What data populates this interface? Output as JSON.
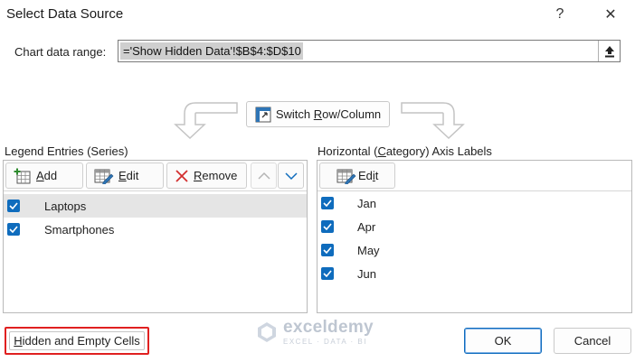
{
  "window": {
    "title": "Select Data Source",
    "help_glyph": "?",
    "close_glyph": "✕"
  },
  "range": {
    "label": "Chart data range:",
    "value": "='Show Hidden Data'!$B$4:$D$10"
  },
  "switch": {
    "label_prefix": "Switch ",
    "label_accel": "R",
    "label_rest": "ow/Column"
  },
  "legend": {
    "title_prefix": "Le",
    "title_accel": "g",
    "title_rest": "end Entries (Series)",
    "add_accel": "A",
    "add_rest": "dd",
    "edit_accel": "E",
    "edit_rest": "dit",
    "remove_accel": "R",
    "remove_rest": "emove",
    "series": [
      {
        "label": "Laptops",
        "checked": true,
        "selected": true
      },
      {
        "label": "Smartphones",
        "checked": true,
        "selected": false
      }
    ]
  },
  "axis": {
    "title_prefix": "Horizontal (",
    "title_accel": "C",
    "title_rest": "ategory) Axis Labels",
    "edit_prefix": "Ed",
    "edit_accel": "i",
    "edit_rest": "t",
    "labels": [
      {
        "label": "Jan",
        "checked": true
      },
      {
        "label": "Apr",
        "checked": true
      },
      {
        "label": "May",
        "checked": true
      },
      {
        "label": "Jun",
        "checked": true
      }
    ]
  },
  "footer": {
    "hidden_accel": "H",
    "hidden_rest": "idden and Empty Cells",
    "ok": "OK",
    "cancel": "Cancel"
  },
  "watermark": {
    "name": "exceldemy",
    "tagline": "EXCEL · DATA · BI"
  },
  "colors": {
    "accent": "#0f6cbd",
    "highlight_border": "#e02020"
  }
}
